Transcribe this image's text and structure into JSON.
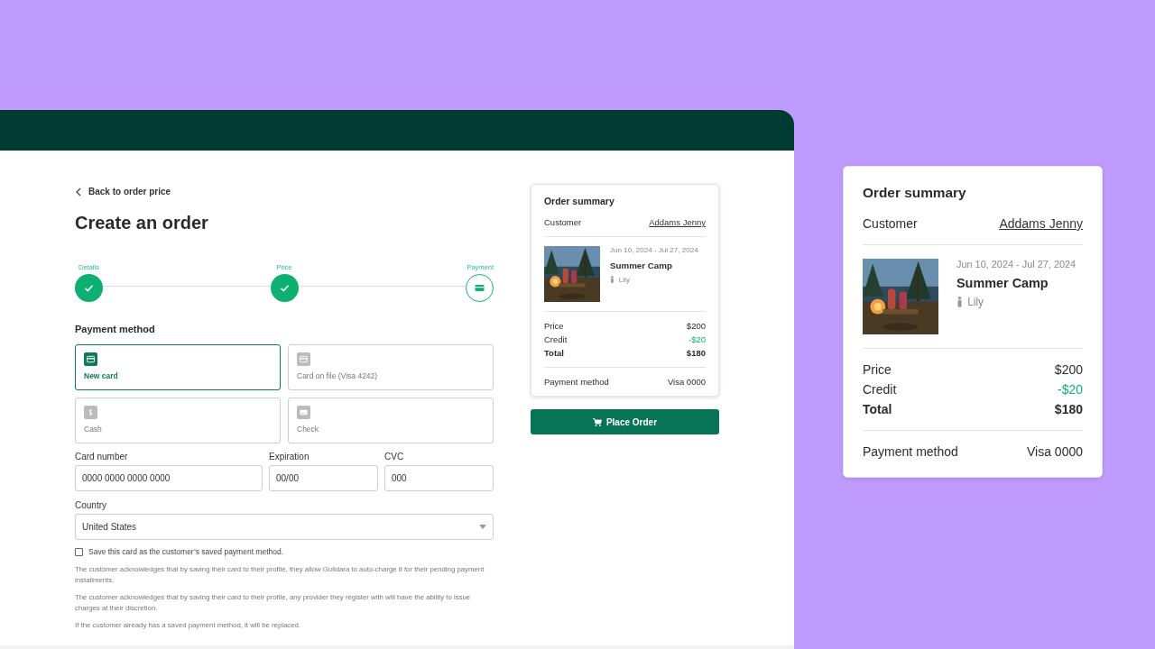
{
  "back_link": "Back to order price",
  "title": "Create an order",
  "steps": [
    {
      "label": "Details",
      "completed": true
    },
    {
      "label": "Price",
      "completed": true
    },
    {
      "label": "Payment",
      "completed": false
    }
  ],
  "payment_method": {
    "heading": "Payment method",
    "options": [
      {
        "label": "New card",
        "kind": "card",
        "selected": true
      },
      {
        "label": "Card on file (Visa 4242)",
        "kind": "card",
        "selected": false
      },
      {
        "label": "Cash",
        "kind": "cash",
        "selected": false
      },
      {
        "label": "Check",
        "kind": "cheque",
        "selected": false
      }
    ]
  },
  "card_fields": [
    {
      "label": "Card number",
      "placeholder": "0000 0000 0000 0000"
    },
    {
      "label": "Expiration",
      "placeholder": "00/00"
    },
    {
      "label": "CVC",
      "placeholder": "000"
    }
  ],
  "country": {
    "label": "Country",
    "value": "United States"
  },
  "save_card": {
    "label": "Save this card as the customer’s saved payment method.",
    "checked": false
  },
  "notes": [
    "The customer acknowledges that by saving their card to their profile, they allow Guildara to auto-charge it for their pending payment installments.",
    "The customer acknowledges that by saving their card to their profile, any provider they register with will have the ability to issue charges at their discretion.",
    "If the customer already has a saved payment method, it will be replaced."
  ],
  "summary": {
    "title": "Order summary",
    "customer_label": "Customer",
    "customer": "Addams Jenny",
    "dates": "Jun 10, 2024 - Jul 27, 2024",
    "program": "Summer Camp",
    "participant": "Lily",
    "lines": [
      {
        "label": "Price",
        "amount": "$200",
        "kind": "normal"
      },
      {
        "label": "Credit",
        "amount": "-$20",
        "kind": "discount"
      },
      {
        "label": "Total",
        "amount": "$180",
        "kind": "total"
      }
    ],
    "payment_label": "Payment method",
    "payment": "Visa 0000"
  },
  "summary_preview": {
    "title": "Order summary",
    "customer_label": "Customer",
    "customer": "Addams Jenny",
    "dates": "Jun 10, 2024 - Jul 27, 2024",
    "program": "Summer Camp",
    "participant": "Lily",
    "lines": [
      {
        "label": "Price",
        "amount": "$200",
        "kind": "normal"
      },
      {
        "label": "Credit",
        "amount": "-$20",
        "kind": "discount"
      },
      {
        "label": "Total",
        "amount": "$180",
        "kind": "total"
      }
    ],
    "payment_label": "Payment method",
    "payment": "Visa 0000"
  },
  "place_order": "Place Order"
}
